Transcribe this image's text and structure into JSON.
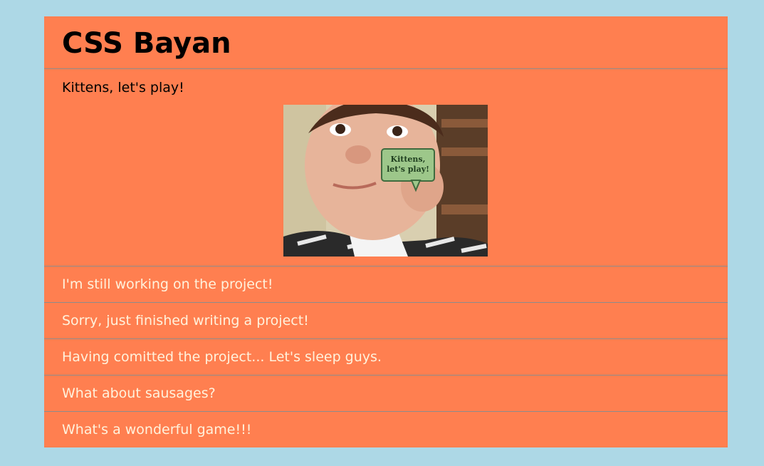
{
  "header": {
    "title": "CSS Bayan"
  },
  "panels": [
    {
      "label": "Kittens, let's play!",
      "open": true,
      "image": {
        "bubble_text_line1": "Kittens,",
        "bubble_text_line2": "let's play!"
      }
    },
    {
      "label": "I'm still working on the project!"
    },
    {
      "label": "Sorry, just finished writing a project!"
    },
    {
      "label": "Having comitted the project... Let's sleep guys."
    },
    {
      "label": "What about sausages?"
    },
    {
      "label": "What's a wonderful game!!!"
    }
  ],
  "colors": {
    "page_background": "#add8e6",
    "accordion_background": "#ff7f50",
    "collapsed_label": "#fff2dc",
    "divider": "#8c8c8c"
  }
}
